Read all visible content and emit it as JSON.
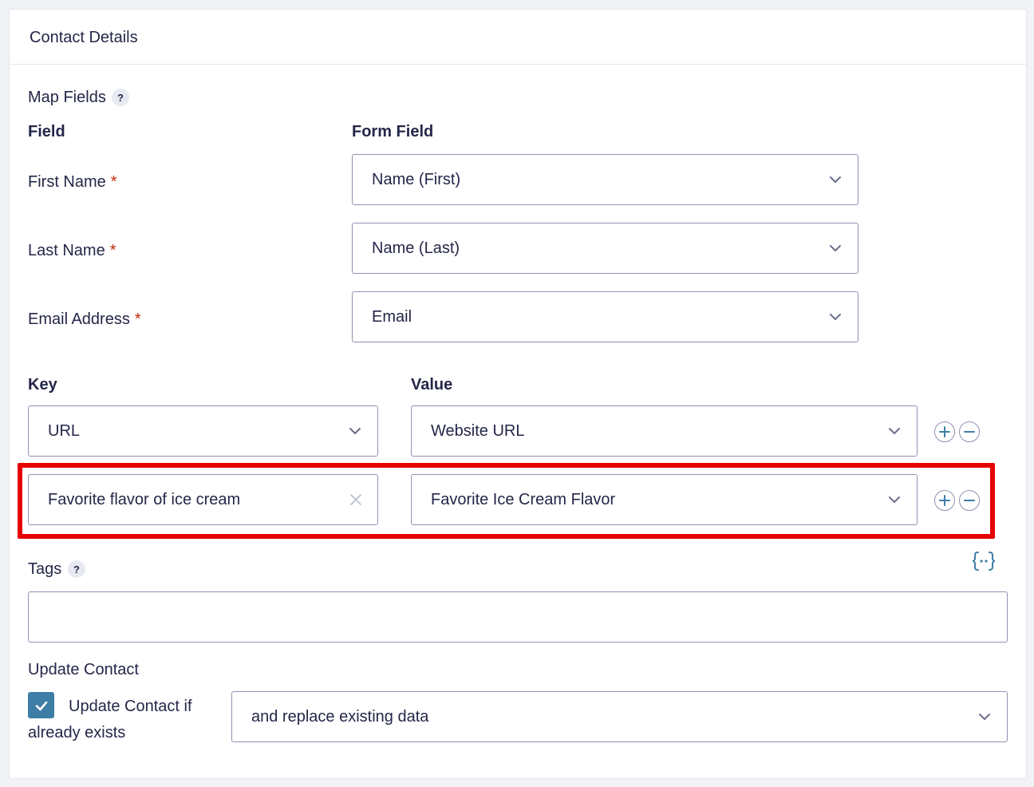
{
  "panel": {
    "title": "Contact Details"
  },
  "map_fields": {
    "label": "Map Fields",
    "help": "?",
    "col_field": "Field",
    "col_form_field": "Form Field",
    "required_mark": "*",
    "rows": [
      {
        "field": "First Name",
        "form_field": "Name (First)"
      },
      {
        "field": "Last Name",
        "form_field": "Name (Last)"
      },
      {
        "field": "Email Address",
        "form_field": "Email"
      }
    ]
  },
  "custom_fields": {
    "col_key": "Key",
    "col_value": "Value",
    "rows": [
      {
        "key": "URL",
        "value": "Website URL"
      },
      {
        "key": "Favorite flavor of ice cream",
        "value": "Favorite Ice Cream Flavor"
      }
    ]
  },
  "tags": {
    "label": "Tags",
    "help": "?",
    "value": ""
  },
  "update_contact": {
    "label": "Update Contact",
    "checkbox_label_line1": "Update Contact if",
    "checkbox_label_line2": "already exists",
    "checked": true,
    "mode": "and replace existing data"
  },
  "colors": {
    "accent": "#3e7da6",
    "required": "#c02b0a",
    "highlight": "#e60000",
    "border": "#9092b2"
  },
  "icons": {
    "dropdown": "chevron-down-icon",
    "clear": "close-icon",
    "add": "plus-circle-icon",
    "remove": "minus-circle-icon",
    "merge_tag": "merge-tag-icon",
    "check": "check-icon"
  }
}
